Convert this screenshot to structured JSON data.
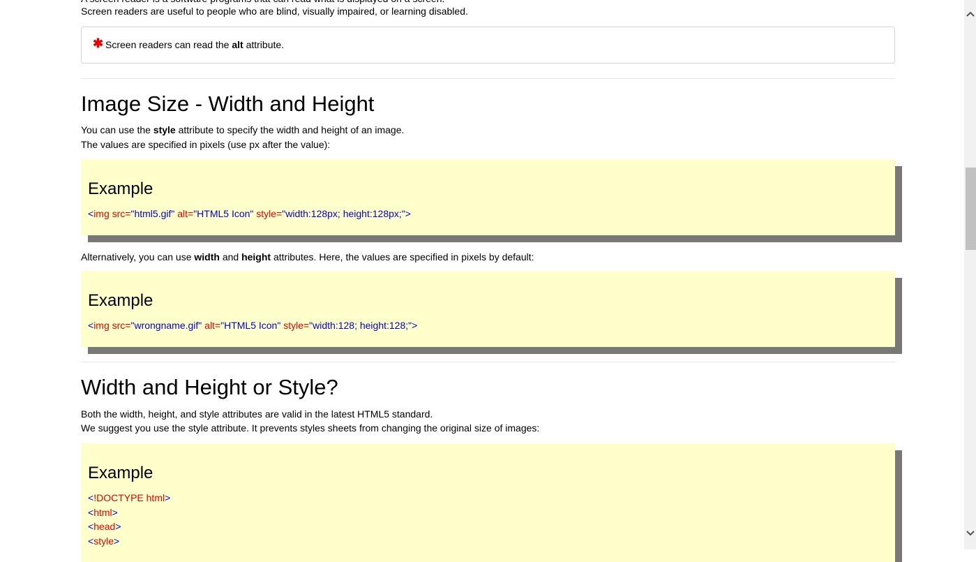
{
  "intro": {
    "line1": "A screen reader is a software programs that can read what is displayed on a screen.",
    "line2": "Screen readers are useful to people who are blind, visually impaired, or learning disabled."
  },
  "note": {
    "before": "Screen readers can read the ",
    "bold": "alt",
    "after": " attribute."
  },
  "section1": {
    "heading": "Image Size - Width and Height",
    "p1_before": "You can use the ",
    "p1_bold": "style",
    "p1_after": " attribute to specify the width and height of an image.",
    "p2": "The values are specified in pixels (use px after the value):",
    "example_title": "Example",
    "code": {
      "open": "<",
      "tag": "img",
      "a1": " src=",
      "v1": "\"html5.gif\"",
      "a2": " alt=",
      "v2": "\"HTML5 Icon\"",
      "a3": " style=",
      "v3": "\"width:128px; height:128px;\"",
      "close": ">"
    }
  },
  "alt_para": {
    "before": "Alternatively, you can use ",
    "b1": "width",
    "mid": " and ",
    "b2": "height",
    "after": " attributes. Here, the values are specified in pixels by default:"
  },
  "example2": {
    "title": "Example",
    "code": {
      "open": "<",
      "tag": "img",
      "a1": " src=",
      "v1": "\"wrongname.gif\"",
      "a2": " alt=",
      "v2": "\"HTML5 Icon\"",
      "a3": " style=",
      "v3": "\"width:128; height:128;\"",
      "close": ">"
    }
  },
  "section2": {
    "heading": "Width and Height or Style?",
    "p1": "Both the width, height, and style attributes are valid in the latest HTML5 standard.",
    "p2": "We suggest you use the style attribute. It prevents styles sheets from changing the original size of images:",
    "example_title": "Example",
    "lines": [
      {
        "open": "<",
        "tag": "!DOCTYPE html",
        "close": ">"
      },
      {
        "open": "<",
        "tag": "html",
        "close": ">"
      },
      {
        "open": "<",
        "tag": "head",
        "close": ">"
      },
      {
        "open": "<",
        "tag": "style",
        "close": ">"
      }
    ]
  },
  "icons": {
    "note": "asterisk-icon",
    "scroll_up": "chevron-up-icon",
    "scroll_down": "chevron-down-icon"
  }
}
